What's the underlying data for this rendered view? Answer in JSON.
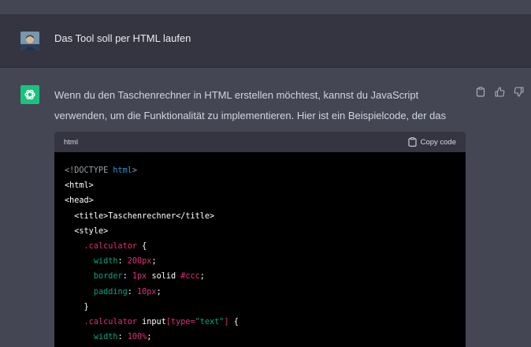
{
  "user_message": {
    "text": "Das Tool soll per HTML laufen"
  },
  "assistant_message": {
    "text": "Wenn du den Taschenrechner in HTML erstellen möchtest, kannst du JavaScript verwenden, um die Funktionalität zu implementieren. Hier ist ein Beispielcode, der das erreichen kann:",
    "code_block": {
      "language": "html",
      "copy_label": "Copy code",
      "lines": [
        "<!DOCTYPE html>",
        "<html>",
        "<head>",
        "  <title>Taschenrechner</title>",
        "  <style>",
        "    .calculator {",
        "      width: 200px;",
        "      border: 1px solid #ccc;",
        "      padding: 10px;",
        "    }",
        "    .calculator input[type=\"text\"] {",
        "      width: 100%;"
      ]
    }
  },
  "actions": [
    "clipboard-icon",
    "thumbs-up-icon",
    "thumbs-down-icon"
  ],
  "colors": {
    "assistant_bg": "#444654",
    "user_bg": "#343541",
    "gpt_avatar": "#19c37d",
    "code_bg": "#000000"
  }
}
